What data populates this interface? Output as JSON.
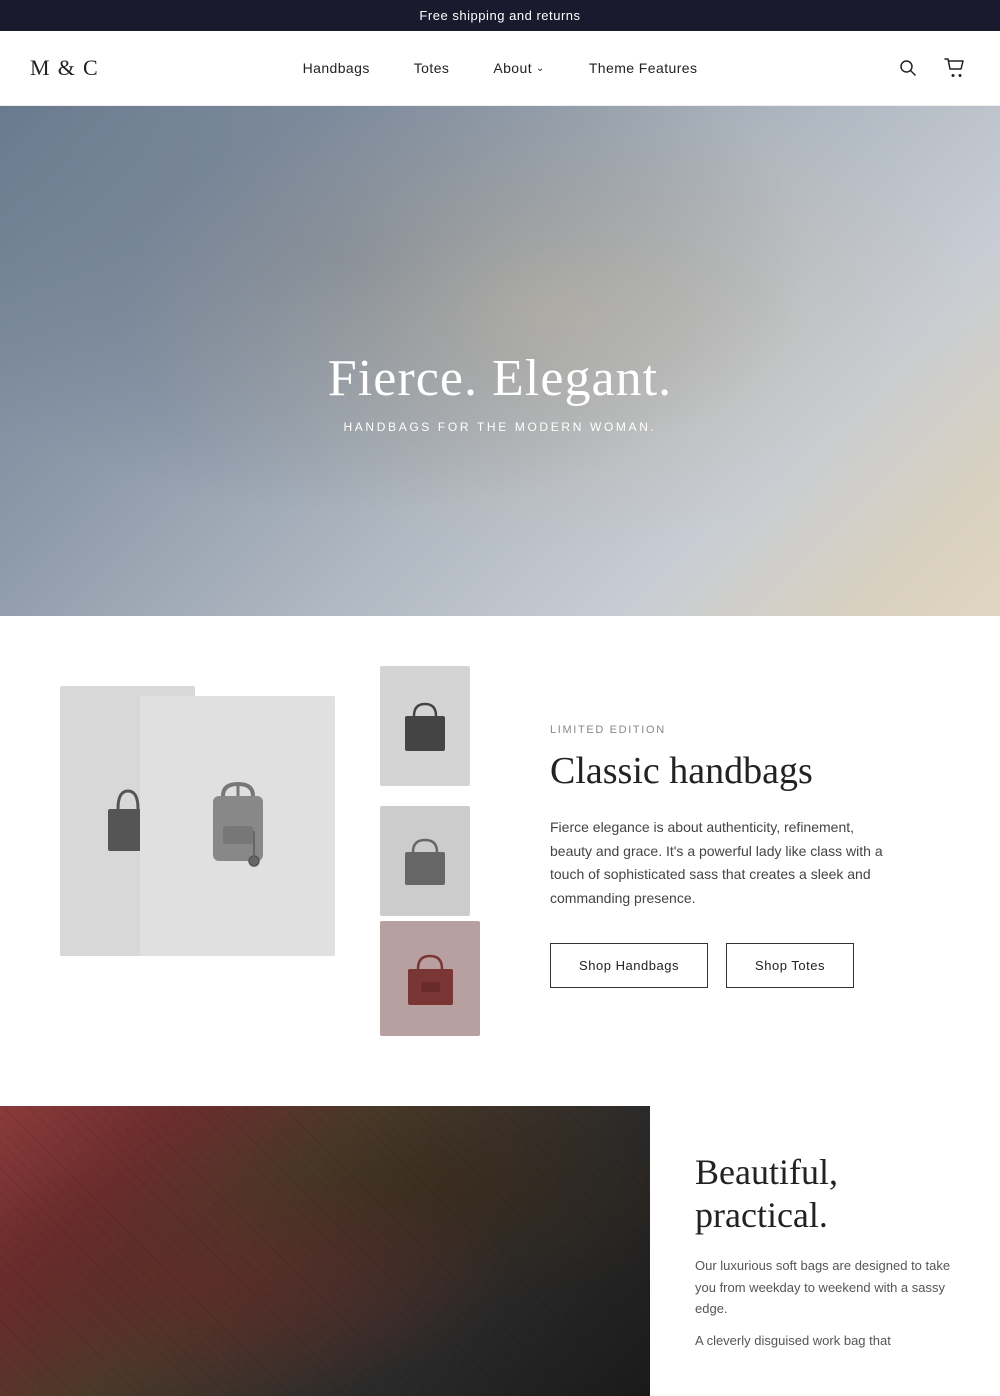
{
  "announcement": {
    "text": "Free shipping and returns"
  },
  "header": {
    "logo": "M & C",
    "nav": [
      {
        "id": "handbags",
        "label": "Handbags",
        "has_dropdown": false
      },
      {
        "id": "totes",
        "label": "Totes",
        "has_dropdown": false
      },
      {
        "id": "about",
        "label": "About",
        "has_dropdown": true
      },
      {
        "id": "theme-features",
        "label": "Theme Features",
        "has_dropdown": false
      }
    ],
    "search_label": "Search",
    "cart_label": "Cart"
  },
  "hero": {
    "title": "Fierce. Elegant.",
    "subtitle": "HANDBAGS FOR THE MODERN WOMAN."
  },
  "feature": {
    "label": "LIMITED EDITION",
    "heading": "Classic handbags",
    "body": "Fierce elegance is about authenticity, refinement, beauty and grace. It's a powerful lady like class with a touch of sophisticated sass that creates a sleek and commanding presence.",
    "btn_handbags": "Shop Handbags",
    "btn_totes": "Shop Totes"
  },
  "second": {
    "heading": "Beautiful, practical.",
    "body": "Our luxurious soft bags are designed to take you from weekday to weekend with a sassy edge.",
    "body2": "A cleverly disguised work bag that"
  }
}
